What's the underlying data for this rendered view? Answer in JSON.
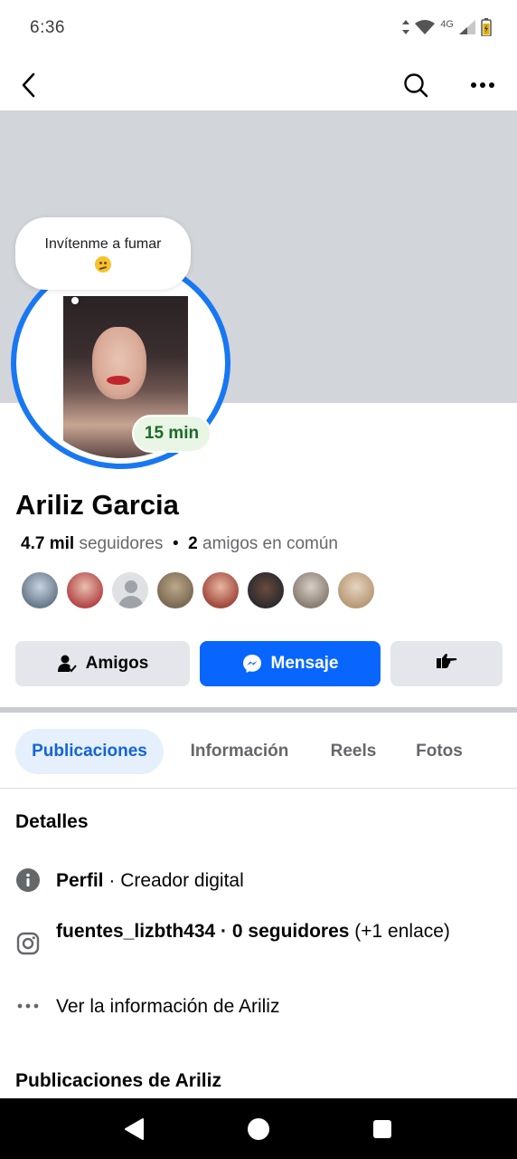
{
  "status_bar": {
    "time": "6:36",
    "network": "4G"
  },
  "nav": {
    "back_icon": "back-arrow-icon",
    "search_icon": "search-icon",
    "more_icon": "more-dots-icon"
  },
  "profile": {
    "note": "Invítenme a fumar",
    "note_emoji": "confused-face-emoji",
    "note_time": "15 min",
    "name": "Ariliz Garcia",
    "followers_count": "4.7 mil",
    "followers_label": "seguidores",
    "mutual_count": "2",
    "mutual_label": "amigos en común",
    "ring_color": "#1877f2"
  },
  "mutual_friends": [
    {
      "name": "friend-1",
      "color": "#6a7a8c"
    },
    {
      "name": "friend-2",
      "color": "#b5484a"
    },
    {
      "name": "friend-3",
      "color": "silhouette"
    },
    {
      "name": "friend-4",
      "color": "#7b6a55"
    },
    {
      "name": "friend-5",
      "color": "#a34a3e"
    },
    {
      "name": "friend-6",
      "color": "#2b2b2e"
    },
    {
      "name": "friend-7",
      "color": "#8a7e74"
    },
    {
      "name": "friend-8",
      "color": "#b89a78"
    }
  ],
  "actions": {
    "friends_label": "Amigos",
    "message_label": "Mensaje",
    "poke_icon": "poke-hand-icon"
  },
  "tabs": [
    {
      "label": "Publicaciones",
      "active": true
    },
    {
      "label": "Información",
      "active": false
    },
    {
      "label": "Reels",
      "active": false
    },
    {
      "label": "Fotos",
      "active": false
    }
  ],
  "details": {
    "title": "Detalles",
    "profile_label": "Perfil",
    "profile_value": " · Creador digital",
    "instagram_handle": "fuentes_lizbth434 · 0 seguidores",
    "instagram_extra": " (+1 enlace)",
    "see_more": "Ver la información de Ariliz"
  },
  "posts_title": "Publicaciones de Ariliz",
  "colors": {
    "accent": "#0866ff",
    "tab_active_bg": "#e6f0fc",
    "cover": "#d2d5da",
    "badge_green": "#1e6b2b"
  }
}
